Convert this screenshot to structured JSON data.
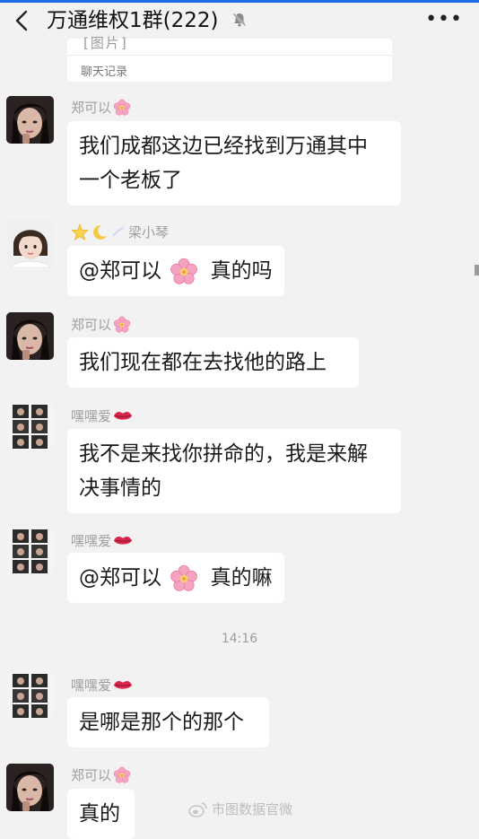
{
  "header": {
    "title": "万通维权1群(222)",
    "more": "•••"
  },
  "card": {
    "partial_text": "[图片]",
    "footer": "聊天记录"
  },
  "messages": [
    {
      "sender": "郑可以",
      "text_lines": [
        "我们成都这边已经找到万通其中",
        "一个老板了"
      ]
    },
    {
      "sender": "梁小琴",
      "mention": "@郑可以",
      "text": "真的吗"
    },
    {
      "sender": "郑可以",
      "text_lines": [
        "我们现在都在去找他的路上"
      ]
    },
    {
      "sender": "嘿嘿爱",
      "text_lines": [
        "我不是来找你拼命的，我是来解",
        "决事情的"
      ]
    },
    {
      "sender": "嘿嘿爱",
      "mention": "@郑可以",
      "text": "真的嘛"
    },
    {
      "sender": "嘿嘿爱",
      "text_lines": [
        "是哪是那个的那个"
      ]
    },
    {
      "sender": "郑可以",
      "text_lines": [
        "真的"
      ]
    }
  ],
  "timestamp": "14:16",
  "watermark": "市图数据官微",
  "icons": {
    "back": "chevron-left-icon",
    "mute": "bell-off-icon",
    "more": "more-dots-icon",
    "flower": "cherry-blossom-icon",
    "lips": "lips-icon",
    "star": "star-icon",
    "moon": "moon-icon"
  },
  "colors": {
    "accent_bar": "#1e6ee8",
    "background": "#f2f2f2",
    "bubble": "#ffffff",
    "name_text": "#9e9e9e"
  }
}
